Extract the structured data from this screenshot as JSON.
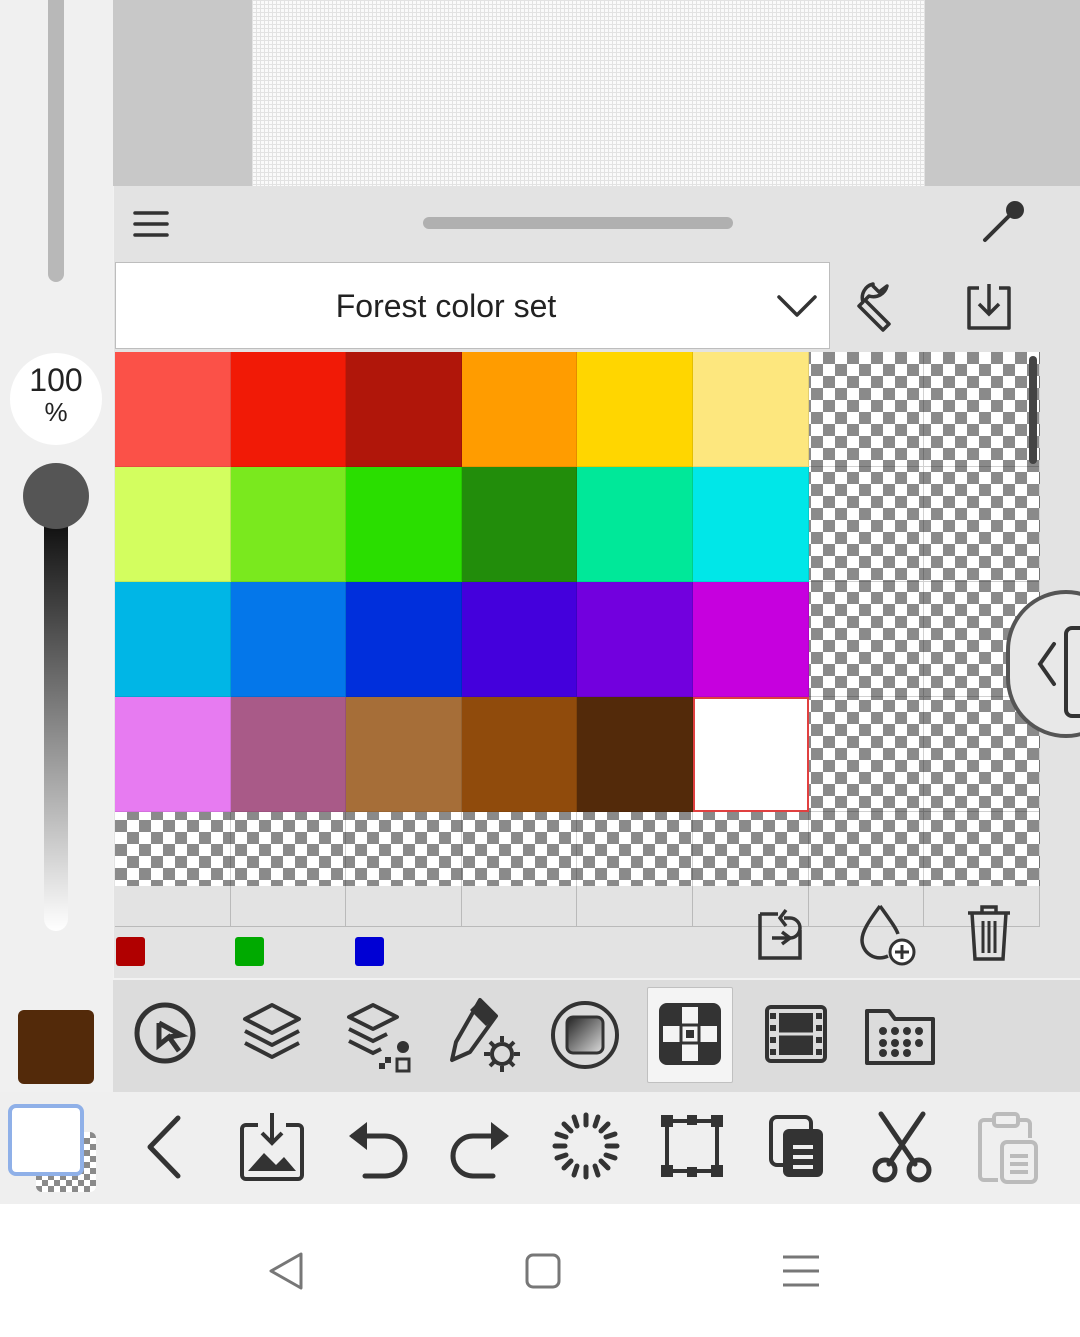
{
  "opacity": {
    "value": "100",
    "unit": "%"
  },
  "current_color": "#532a0a",
  "palette": {
    "set_name": "Forest color set",
    "rows": [
      [
        "#fb5148",
        "#f11a06",
        "#b0160a",
        "#ff9c00",
        "#ffd600",
        "#fde77e"
      ],
      [
        "#d3fe5f",
        "#7ae91e",
        "#2ade00",
        "#228d0b",
        "#00e899",
        "#00e7e8"
      ],
      [
        "#00b6e6",
        "#0477ea",
        "#002fdc",
        "#4400dc",
        "#7200de",
        "#c600de"
      ],
      [
        "#e77bf1",
        "#a95a88",
        "#a66e38",
        "#904b0c",
        "#532a0a",
        "#ffffff"
      ]
    ],
    "selected": {
      "row": 3,
      "col": 5
    },
    "recent_colors": [
      "#b00000",
      "#00aa00",
      "#0000d4"
    ]
  },
  "colors": {
    "panel_bg": "#e3e3e3",
    "toolbar_bg": "#dcdcdc",
    "icon": "#333333",
    "selection_border": "#e04040"
  }
}
